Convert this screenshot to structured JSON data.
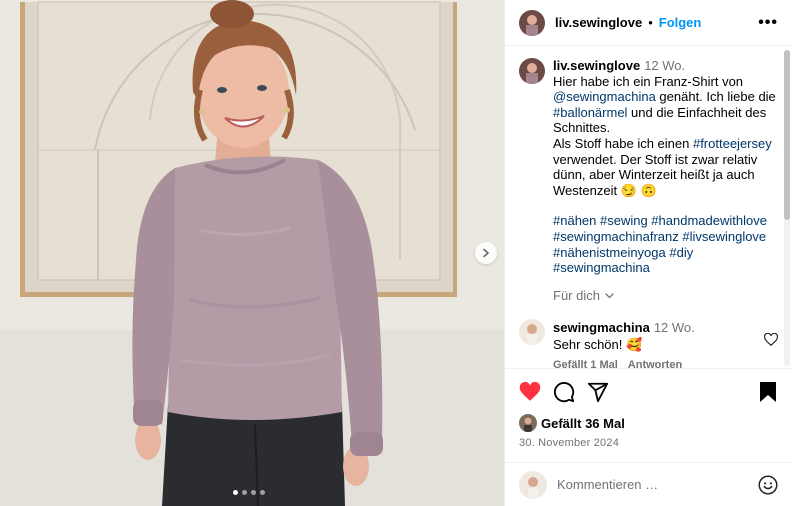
{
  "post": {
    "username": "liv.sewinglove",
    "follow_label": "Folgen",
    "more_label": "•••"
  },
  "caption": {
    "username": "liv.sewinglove",
    "age": "12 Wo.",
    "lines": [
      "Hier habe ich ein Franz-Shirt von",
      "@sewingmachina",
      " genäht. Ich liebe die",
      "#ballonärmel",
      " und die Einfachheit des",
      "Schnittes.",
      "Als Stoff habe ich einen ",
      "#frotteejersey",
      "verwendet. Der Stoff ist zwar relativ",
      "dünn, aber Winterzeit heißt ja auch",
      "Westenzeit 😏 🙃"
    ],
    "hashtags": [
      "#nähen #sewing #handmadewithlove",
      "#sewingmachinafranz #livsewinglove",
      "#nähenistmeinyoga #diy",
      "#sewingmachina"
    ],
    "more_label": "Für dich",
    "more_chevron": "⌄"
  },
  "comment": {
    "username": "sewingmachina",
    "age": "12 Wo.",
    "text": "Sehr schön! 🥰",
    "likes": "Gefällt 1 Mal",
    "reply": "Antworten"
  },
  "actions": {
    "likes_text": "Gefällt 36 Mal",
    "date": "30. November 2024",
    "comment_placeholder": "Kommentieren …",
    "like_color": "#ff3040"
  },
  "carousel": {
    "slide_count": 4,
    "active_index": 0
  }
}
